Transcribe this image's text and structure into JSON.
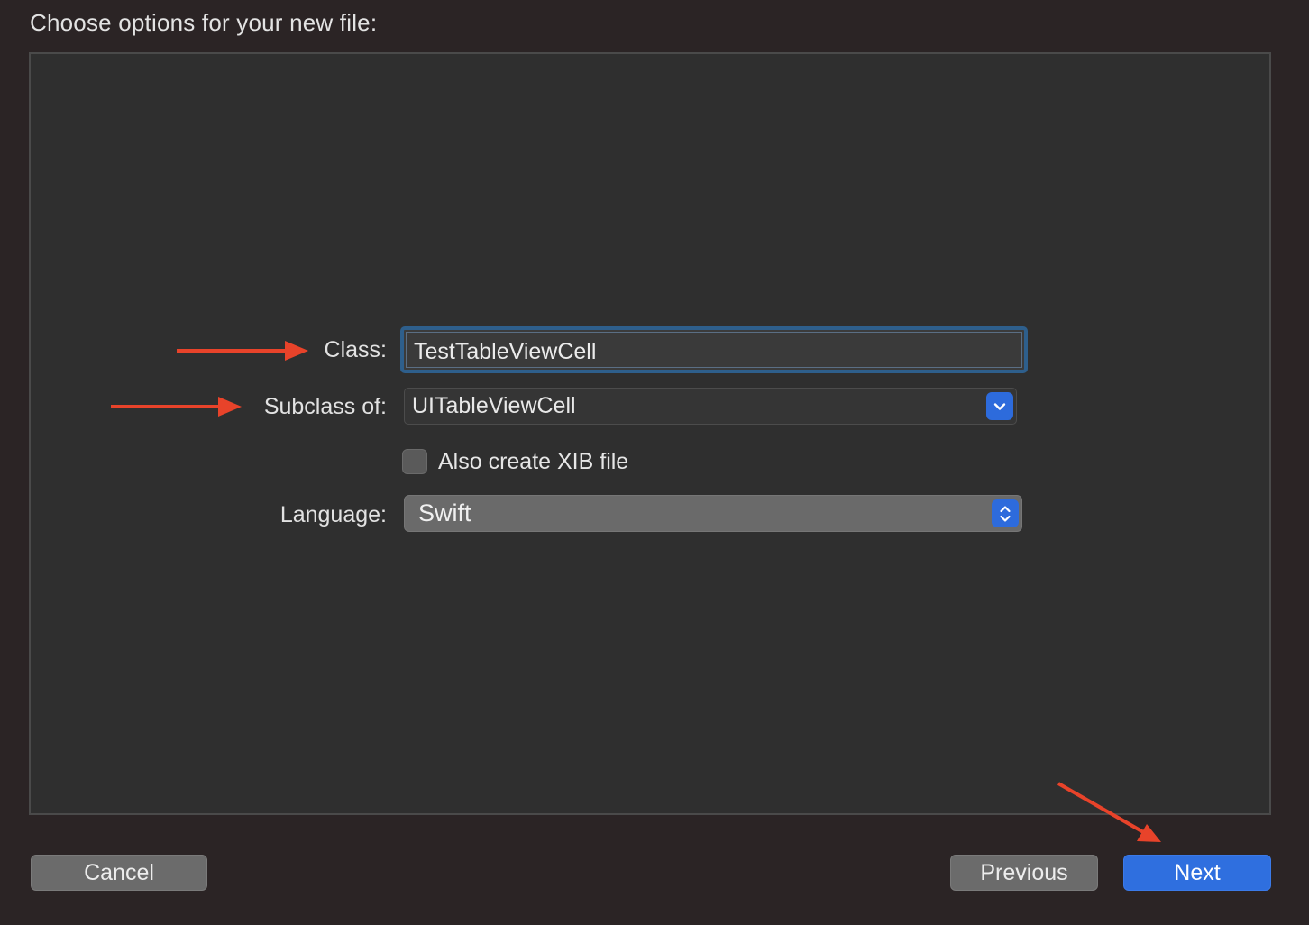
{
  "dialog": {
    "heading": "Choose options for your new file:"
  },
  "form": {
    "class_label": "Class:",
    "class_value": "TestTableViewCell",
    "subclass_label": "Subclass of:",
    "subclass_value": "UITableViewCell",
    "xib_label": "Also create XIB file",
    "xib_checked": false,
    "language_label": "Language:",
    "language_value": "Swift"
  },
  "buttons": {
    "cancel": "Cancel",
    "previous": "Previous",
    "next": "Next"
  },
  "colors": {
    "background": "#2b2425",
    "panel": "#2f2f2f",
    "accent": "#2f6fdf",
    "annotation_arrow": "#e8432a"
  }
}
